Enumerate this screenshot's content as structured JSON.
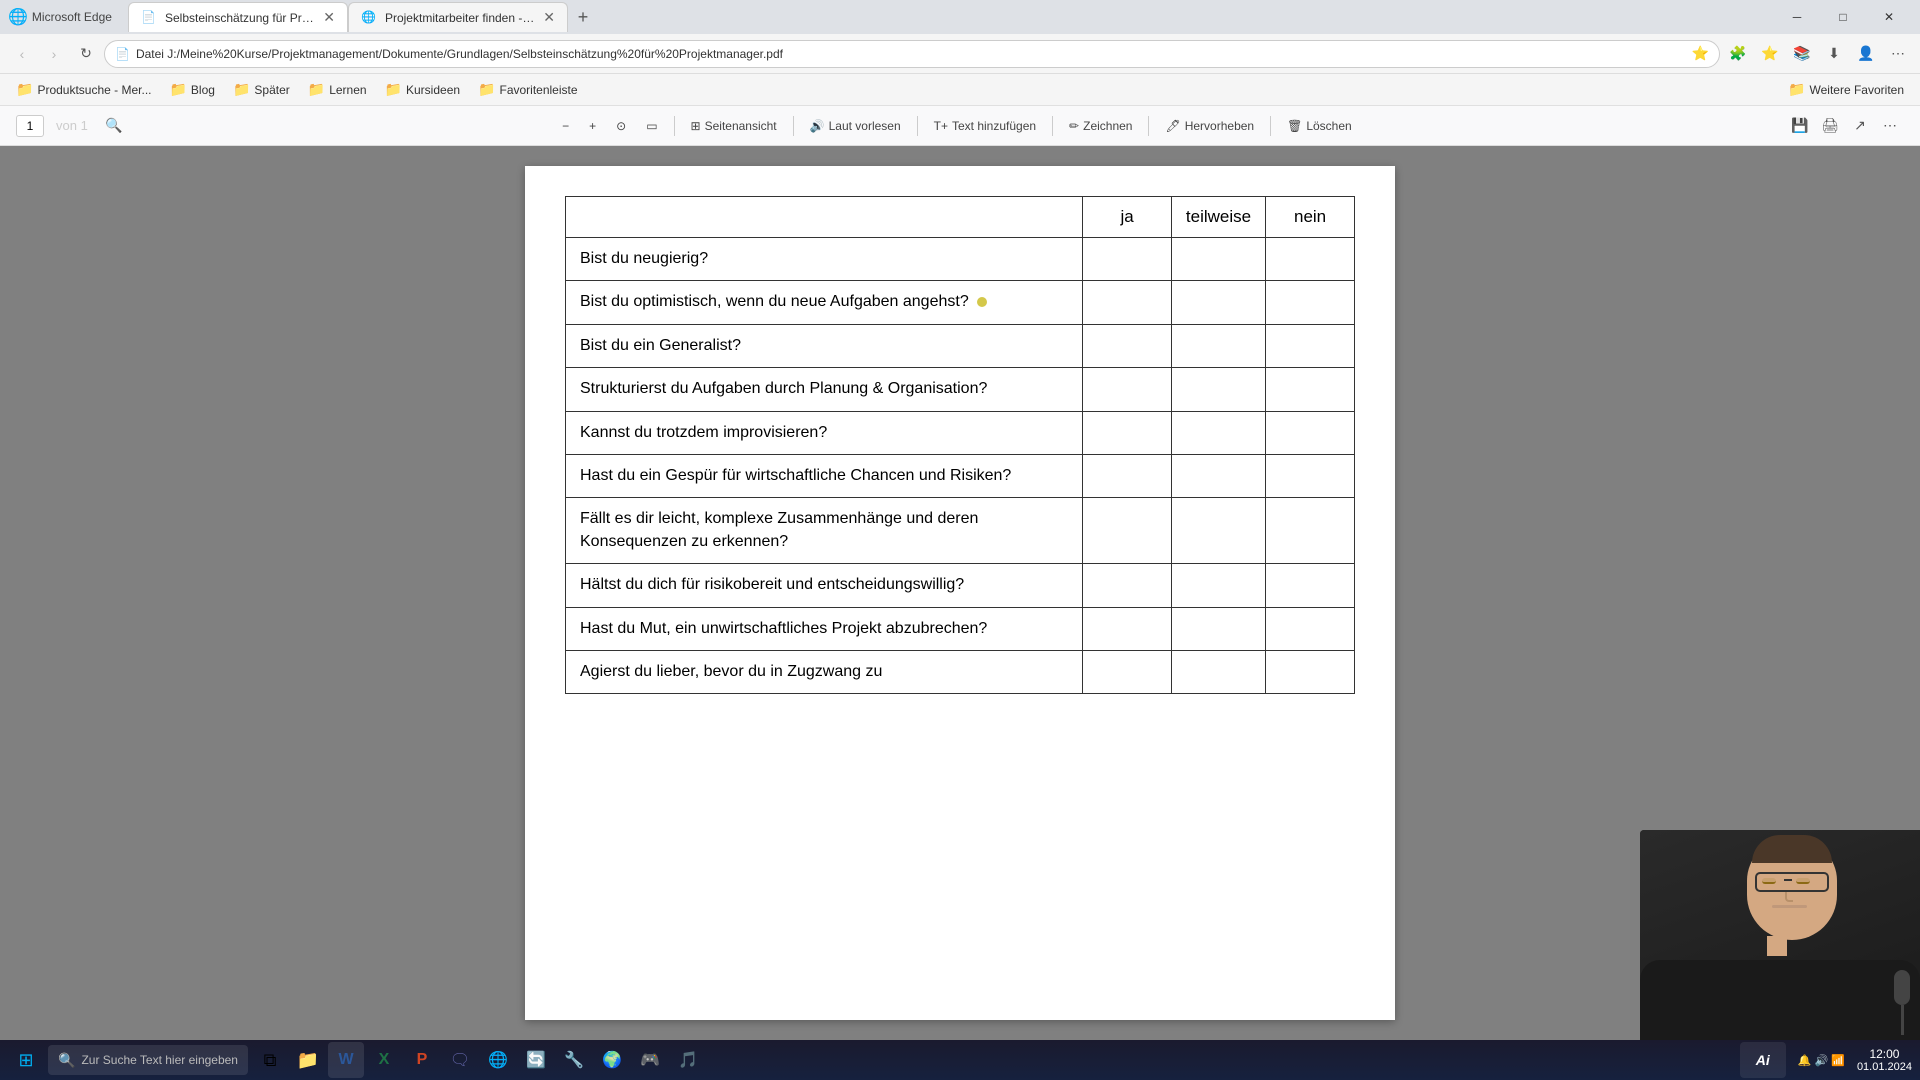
{
  "browser": {
    "tabs": [
      {
        "id": "tab1",
        "title": "Selbsteinschätzung für Projektm...",
        "active": true,
        "favicon": "📄"
      },
      {
        "id": "tab2",
        "title": "Projektmitarbeiter finden - was ...",
        "active": false,
        "favicon": "🌐"
      }
    ],
    "address": "Datei    J:/Meine%20Kurse/Projektmanagement/Dokumente/Grundlagen/Selbsteinschätzung%20für%20Projektmanager.pdf",
    "bookmarks": [
      {
        "label": "Produktsuche - Mer...",
        "icon": "📁"
      },
      {
        "label": "Blog",
        "icon": "📁"
      },
      {
        "label": "Später",
        "icon": "📁"
      },
      {
        "label": "Lernen",
        "icon": "📁"
      },
      {
        "label": "Kursideen",
        "icon": "📁"
      },
      {
        "label": "Favoritenleiste",
        "icon": "📁"
      },
      {
        "label": "Weitere Favoriten",
        "icon": "📁"
      }
    ]
  },
  "pdf_toolbar": {
    "page_current": "1",
    "page_total": "1",
    "search_icon": "🔍",
    "zoom_out": "−",
    "zoom_in": "+",
    "fit": "⊙",
    "view": "▭",
    "seitenansicht": "Seitenansicht",
    "laut_vorlesen": "Laut vorlesen",
    "text_hinzufuegen": "Text hinzufügen",
    "zeichnen": "Zeichnen",
    "hervorheben": "Hervorheben",
    "loeschen": "Löschen"
  },
  "table": {
    "header": {
      "col1": "",
      "col2": "ja",
      "col3": "teilweise",
      "col4": "nein"
    },
    "rows": [
      {
        "question": "Bist du neugierig?",
        "has_cursor": false
      },
      {
        "question": "Bist du optimistisch, wenn du neue Aufgaben angehst?",
        "has_cursor": true
      },
      {
        "question": "Bist du ein Generalist?",
        "has_cursor": false
      },
      {
        "question": "Strukturierst du Aufgaben durch Planung & Organisation?",
        "has_cursor": false
      },
      {
        "question": "Kannst du trotzdem improvisieren?",
        "has_cursor": false
      },
      {
        "question": "Hast du ein Gespür für wirtschaftliche Chancen und Risiken?",
        "has_cursor": false
      },
      {
        "question": "Fällt es dir leicht, komplexe Zusammenhänge und deren Konsequenzen zu erkennen?",
        "has_cursor": false
      },
      {
        "question": "Hältst du dich für risikobereit und entscheidungswillig?",
        "has_cursor": false
      },
      {
        "question": "Hast du Mut, ein unwirtschaftliches Projekt abzubrechen?",
        "has_cursor": false
      },
      {
        "question": "Agierst du lieber, bevor du in Zugzwang zu",
        "has_cursor": false
      }
    ]
  },
  "taskbar": {
    "search_placeholder": "Zur Suche Text hier eingeben",
    "time": "...",
    "date": "...",
    "apps": [
      "⊞",
      "📁",
      "W",
      "X",
      "P",
      "🗨",
      "🌐",
      "🔄",
      "🎵",
      "🔧",
      "🌍",
      "🎮",
      "🎵"
    ],
    "ai_label": "Ai"
  }
}
